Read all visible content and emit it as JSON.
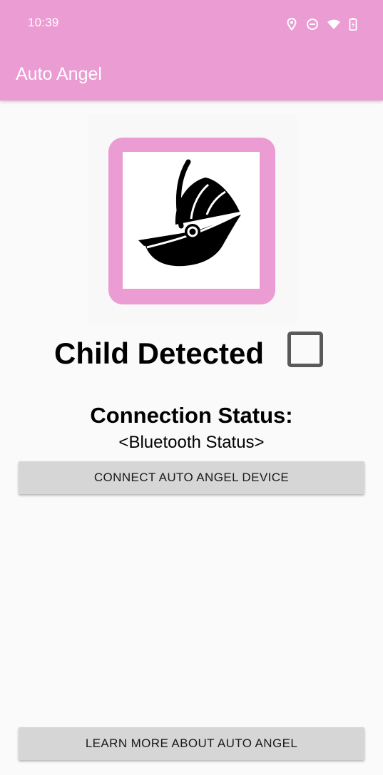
{
  "status_bar": {
    "time": "10:39",
    "icons": [
      "location-icon",
      "do-not-disturb-icon",
      "wifi-icon",
      "battery-icon"
    ]
  },
  "app_bar": {
    "title": "Auto Angel",
    "color": "#ea9cd3"
  },
  "logo": {
    "icon": "infant-car-seat-icon",
    "frame_color": "#ea9cd3"
  },
  "child_detection": {
    "label": "Child Detected",
    "checked": false
  },
  "connection": {
    "label": "Connection Status:",
    "status": "<Bluetooth Status>"
  },
  "buttons": {
    "connect_label": "CONNECT AUTO ANGEL DEVICE",
    "learn_label": "LEARN MORE ABOUT AUTO ANGEL"
  }
}
